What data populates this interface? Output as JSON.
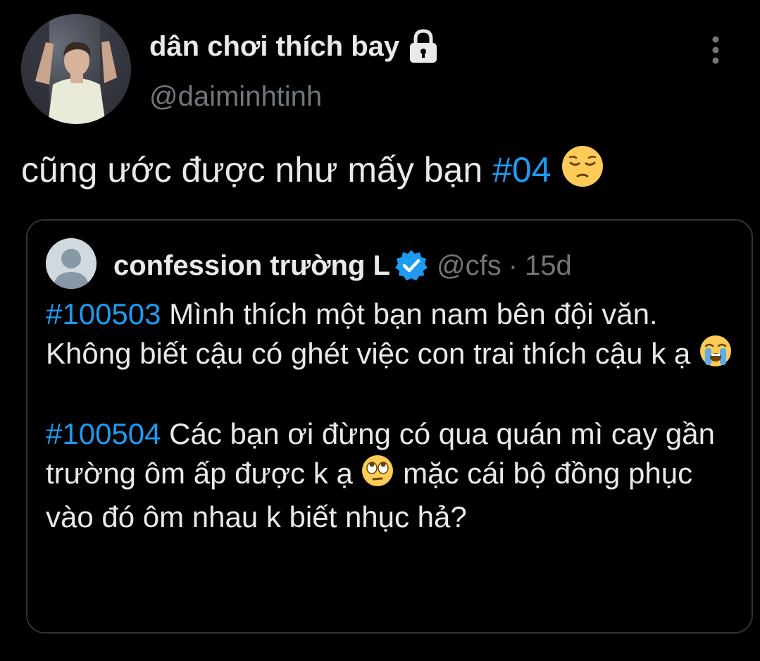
{
  "tweet": {
    "author": {
      "display_name": "dân chơi thích bay",
      "handle": "@daiminhtinh",
      "protected_icon": "lock-icon",
      "avatar": "profile-photo"
    },
    "text_before_hashtag": "cũng ước được như mấy bạn ",
    "hashtag": "#04",
    "emoji": "pensive-face",
    "menu_icon": "more-vertical-icon"
  },
  "quoted_tweet": {
    "author": {
      "display_name": "confession trường L",
      "handle": "@cfs",
      "separator": "·",
      "time": "15d",
      "verified_icon": "verified-badge-icon",
      "avatar": "default-avatar"
    },
    "posts": [
      {
        "hashtag": "#100503",
        "text": " Mình thích một bạn nam bên đội văn. Không biết cậu có ghét việc con trai thích cậu k ạ ",
        "emoji": "loudly-crying-face"
      },
      {
        "hashtag": "#100504",
        "text_before_emoji": " Các bạn ơi đừng có qua quán mì cay gần trường ôm ấp được k ạ ",
        "emoji": "rolling-eyes-face",
        "text_after_emoji": " mặc cái bộ đồng phục vào đó ôm nhau k biết nhục hả?"
      }
    ]
  },
  "colors": {
    "background": "#000000",
    "text": "#e7e9ea",
    "secondary": "#71767b",
    "accent": "#1d9bf0",
    "border": "#2f3336"
  }
}
